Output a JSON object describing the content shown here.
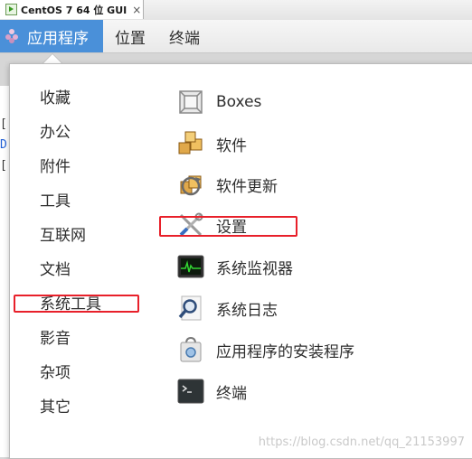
{
  "vm_tab": {
    "title": "CentOS 7 64 位 GUI",
    "close_glyph": "×"
  },
  "topbar": {
    "applications": "应用程序",
    "places": "位置",
    "terminal": "终端"
  },
  "background_fragments": [
    "[",
    "D",
    "["
  ],
  "menu": {
    "categories": [
      "收藏",
      "办公",
      "附件",
      "工具",
      "互联网",
      "文档",
      "系统工具",
      "影音",
      "杂项",
      "其它"
    ],
    "selected_category": "系统工具",
    "apps": [
      {
        "label": "Boxes",
        "icon": "boxes-icon"
      },
      {
        "label": "软件",
        "icon": "software-icon"
      },
      {
        "label": "软件更新",
        "icon": "software-update-icon"
      },
      {
        "label": "设置",
        "icon": "settings-icon"
      },
      {
        "label": "系统监视器",
        "icon": "system-monitor-icon"
      },
      {
        "label": "系统日志",
        "icon": "system-log-icon"
      },
      {
        "label": "应用程序的安装程序",
        "icon": "package-installer-icon"
      },
      {
        "label": "终端",
        "icon": "terminal-icon"
      }
    ]
  },
  "highlight_color": "#e8202a",
  "accent_color": "#4a90d9",
  "watermark": "https://blog.csdn.net/qq_21153997"
}
